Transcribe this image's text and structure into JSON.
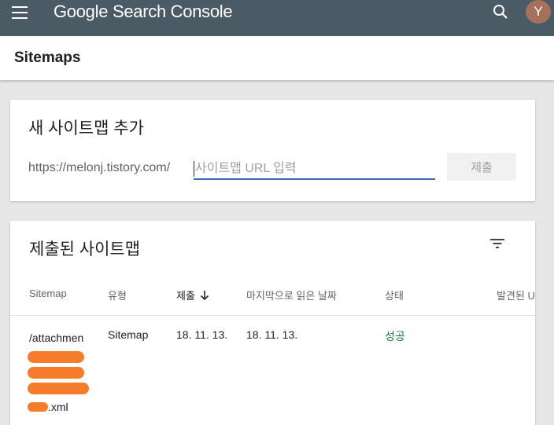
{
  "topbar": {
    "brand_google": "Google",
    "brand_product": "Search Console",
    "avatar_letter": "Y"
  },
  "page": {
    "title": "Sitemaps"
  },
  "add_sitemap": {
    "heading": "새 사이트맵 추가",
    "url_prefix": "https://melonj.tistory.com/",
    "input_placeholder": "사이트맵 URL 입력",
    "input_value": "",
    "submit_label": "제출"
  },
  "submitted": {
    "heading": "제출된 사이트맵",
    "columns": {
      "sitemap": "Sitemap",
      "type": "유형",
      "submitted": "제출",
      "last_read": "마지막으로 읽은 날짜",
      "status": "상태",
      "discovered": "발견된 U"
    },
    "rows": [
      {
        "sitemap_start": "/attachmen",
        "sitemap_end": ".xml",
        "type": "Sitemap",
        "submitted": "18. 11. 13.",
        "last_read": "18. 11. 13.",
        "status": "성공"
      }
    ]
  },
  "colors": {
    "topbar": "#4a5b66",
    "status_success": "#188038",
    "input_underline": "#3a6fb5",
    "redaction": "#f57c2a"
  }
}
